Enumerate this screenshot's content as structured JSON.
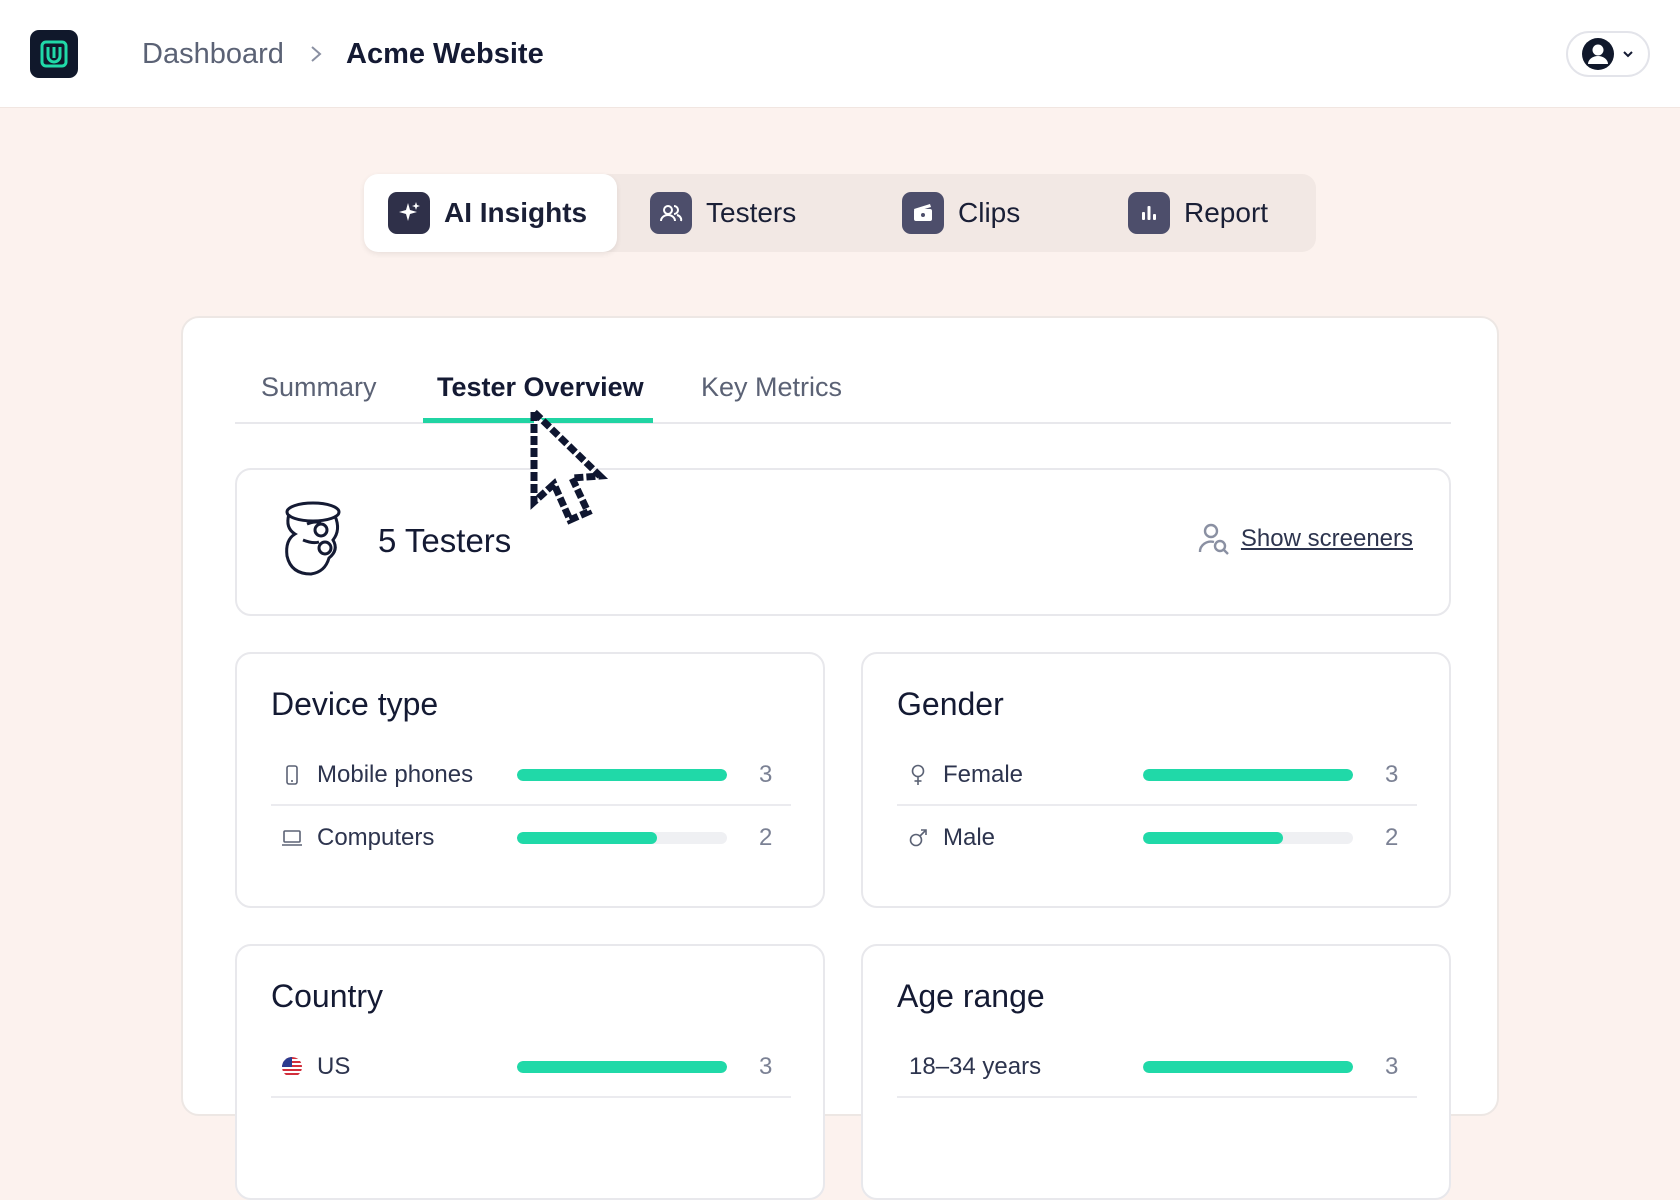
{
  "header": {
    "breadcrumb_root": "Dashboard",
    "breadcrumb_current": "Acme Website"
  },
  "nav": {
    "items": [
      {
        "label": "AI Insights",
        "icon": "sparkle-icon",
        "active": true
      },
      {
        "label": "Testers",
        "icon": "users-icon",
        "active": false
      },
      {
        "label": "Clips",
        "icon": "clapperboard-icon",
        "active": false
      },
      {
        "label": "Report",
        "icon": "bar-chart-icon",
        "active": false
      }
    ]
  },
  "tabs": {
    "summary": "Summary",
    "tester_overview": "Tester Overview",
    "key_metrics": "Key Metrics",
    "active": "Tester Overview"
  },
  "testers": {
    "count_label": "5 Testers",
    "show_screeners": "Show screeners"
  },
  "device_type": {
    "title": "Device type",
    "rows": [
      {
        "label": "Mobile phones",
        "icon": "mobile-icon",
        "count": "3",
        "fraction": 1.0
      },
      {
        "label": "Computers",
        "icon": "laptop-icon",
        "count": "2",
        "fraction": 0.667
      }
    ]
  },
  "gender": {
    "title": "Gender",
    "rows": [
      {
        "label": "Female",
        "icon": "female-icon",
        "count": "3",
        "fraction": 1.0
      },
      {
        "label": "Male",
        "icon": "male-icon",
        "count": "2",
        "fraction": 0.667
      }
    ]
  },
  "country": {
    "title": "Country",
    "rows": [
      {
        "label": "US",
        "icon": "us-flag-icon",
        "count": "3",
        "fraction": 1.0
      }
    ]
  },
  "age_range": {
    "title": "Age range",
    "rows": [
      {
        "label": "18–34 years",
        "count": "3",
        "fraction": 1.0
      }
    ]
  },
  "colors": {
    "accent": "#20d9a8",
    "dark": "#10182b",
    "background": "#fcf2ee"
  }
}
